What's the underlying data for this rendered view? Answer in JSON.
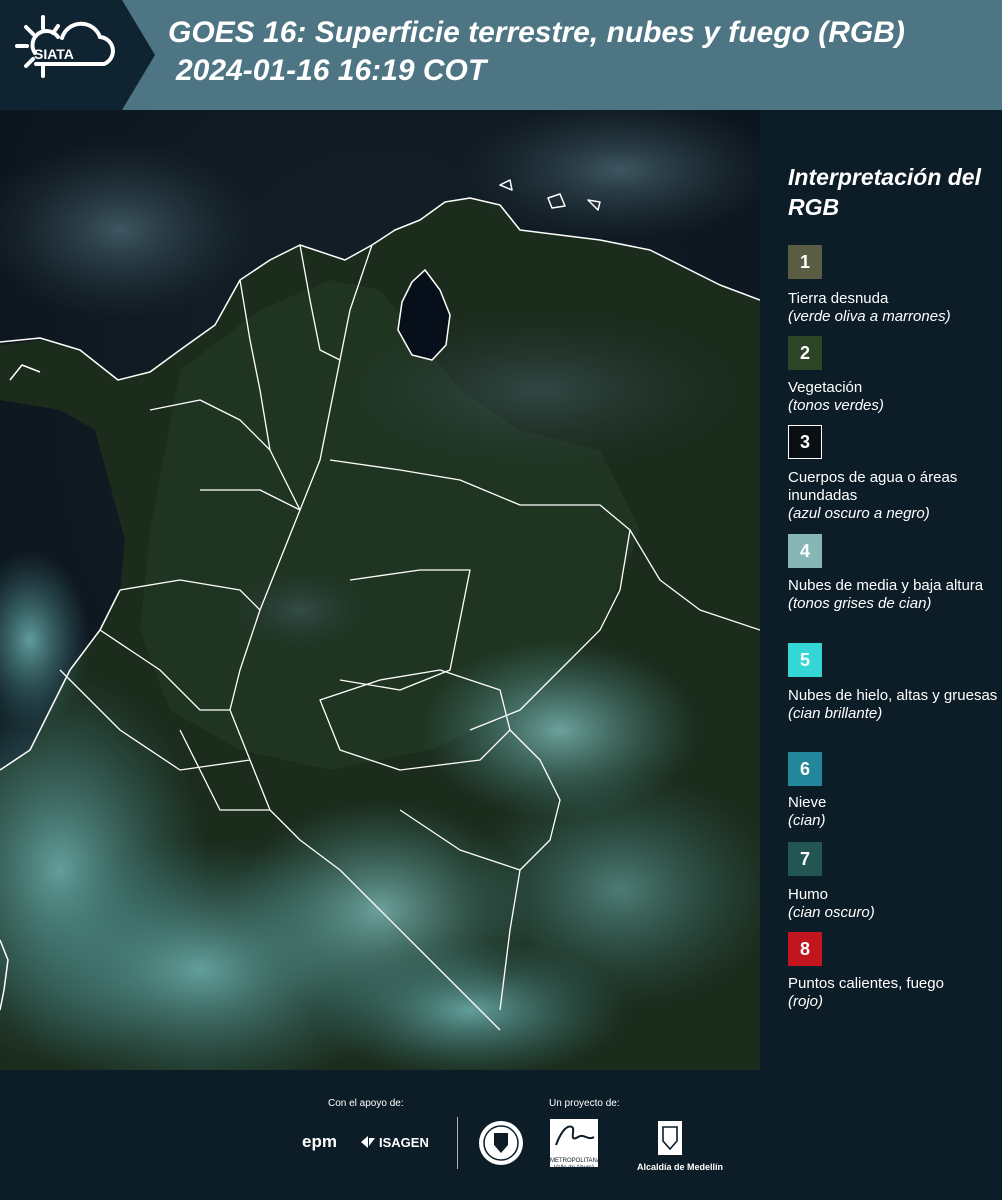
{
  "header": {
    "logo_text": "SIATA",
    "title": "GOES 16: Superficie terrestre, nubes y fuego (RGB)",
    "subtitle": "2024-01-16 16:19 COT"
  },
  "legend": {
    "title": "Interpretación del RGB",
    "items": [
      {
        "number": "1",
        "label": "Tierra desnuda",
        "note": "(verde oliva a marrones)",
        "color": "#5a5d44"
      },
      {
        "number": "2",
        "label": "Vegetación",
        "note": "(tonos verdes)",
        "color": "#2d4426"
      },
      {
        "number": "3",
        "label": "Cuerpos de agua o áreas inundadas",
        "note": "(azul oscuro a negro)",
        "color": "#0a0f14"
      },
      {
        "number": "4",
        "label": "Nubes de media y baja altura",
        "note": "(tonos grises de cian)",
        "color": "#87b7b5"
      },
      {
        "number": "5",
        "label": "Nubes de hielo, altas y gruesas",
        "note": "(cian brillante)",
        "color": "#34d7d6"
      },
      {
        "number": "6",
        "label": "Nieve",
        "note": "(cian)",
        "color": "#23879b"
      },
      {
        "number": "7",
        "label": "Humo",
        "note": "(cian oscuro)",
        "color": "#235552"
      },
      {
        "number": "8",
        "label": "Puntos calientes, fuego",
        "note": "(rojo)",
        "color": "#c1161d"
      }
    ]
  },
  "footer": {
    "support_label": "Con el apoyo de:",
    "project_label": "Un proyecto de:",
    "sponsors": [
      "epm",
      "ISAGEN"
    ],
    "partners": [
      "METROPOLITANA",
      "Valle de Aburrá",
      "Alcaldía de Medellín"
    ]
  }
}
